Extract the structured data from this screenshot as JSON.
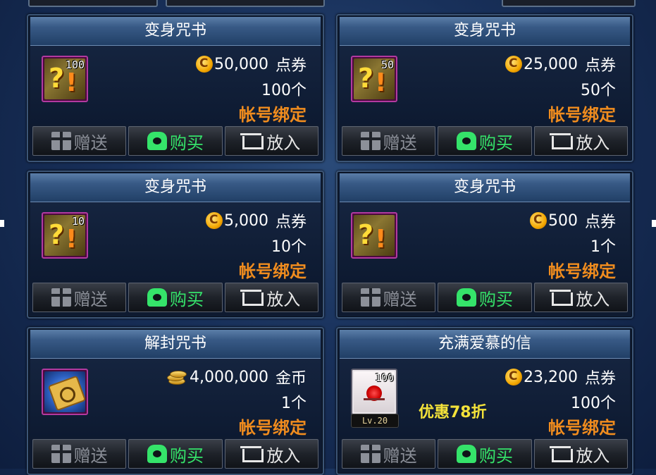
{
  "colors": {
    "background": "#18305a",
    "title_bar": "#385a86",
    "bind_text": "#f08c1e",
    "buy_text": "#35e36a",
    "discount_text": "#f3e23a"
  },
  "buttons": {
    "gift": "赠送",
    "buy": "购买",
    "cart": "放入"
  },
  "items": [
    {
      "title": "变身咒书",
      "icon": "scroll-icon",
      "icon_qty": "100",
      "price": "50,000",
      "currency": "点券",
      "currency_icon": "coupon-icon",
      "count": "100个",
      "bind": "帐号绑定"
    },
    {
      "title": "变身咒书",
      "icon": "scroll-icon",
      "icon_qty": "50",
      "price": "25,000",
      "currency": "点券",
      "currency_icon": "coupon-icon",
      "count": "50个",
      "bind": "帐号绑定"
    },
    {
      "title": "变身咒书",
      "icon": "scroll-icon",
      "icon_qty": "10",
      "price": "5,000",
      "currency": "点券",
      "currency_icon": "coupon-icon",
      "count": "10个",
      "bind": "帐号绑定"
    },
    {
      "title": "变身咒书",
      "icon": "scroll-icon",
      "icon_qty": "",
      "price": "500",
      "currency": "点券",
      "currency_icon": "coupon-icon",
      "count": "1个",
      "bind": "帐号绑定"
    },
    {
      "title": "解封咒书",
      "icon": "seal-scroll-icon",
      "icon_qty": "",
      "price": "4,000,000",
      "currency": "金币",
      "currency_icon": "gold-icon",
      "count": "1个",
      "bind": "帐号绑定"
    },
    {
      "title": "充满爱慕的信",
      "icon": "letter-icon",
      "icon_qty": "100",
      "level": "Lv.20",
      "discount": "优惠78折",
      "price": "23,200",
      "currency": "点券",
      "currency_icon": "coupon-icon",
      "count": "100个",
      "bind": "帐号绑定"
    }
  ]
}
